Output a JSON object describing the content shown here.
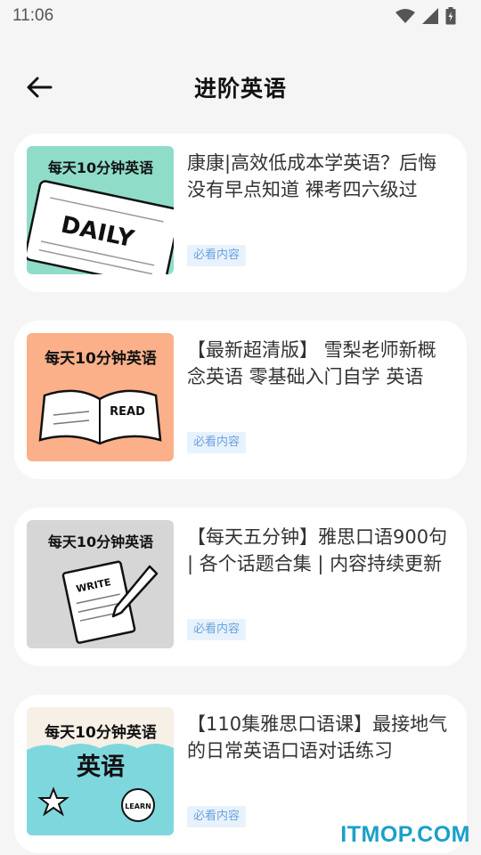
{
  "status_bar": {
    "time": "11:06",
    "icons": [
      "wifi-icon",
      "signal-icon",
      "battery-charging-icon"
    ]
  },
  "header": {
    "back_icon": "arrow-left-icon",
    "title": "进阶英语"
  },
  "courses": [
    {
      "title": "康康|高效低成本学英语？后悔没有早点知道 裸考四六级过",
      "tag": "必看内容",
      "thumb_caption": "每天10分钟英语",
      "thumb_word": "DAILY",
      "thumb_bg": "#8fdcc9"
    },
    {
      "title": "【最新超清版】 雪梨老师新概念英语  零基础入门自学 英语",
      "tag": "必看内容",
      "thumb_caption": "每天10分钟英语",
      "thumb_word": "READ",
      "thumb_bg": "#fbb08a"
    },
    {
      "title": "【每天五分钟】雅思口语900句 | 各个话题合集 | 内容持续更新",
      "tag": "必看内容",
      "thumb_caption": "每天10分钟英语",
      "thumb_word": "WRITE",
      "thumb_bg": "#d6d6d6"
    },
    {
      "title": "【110集雅思口语课】最接地气的日常英语口语对话练习",
      "tag": "必看内容",
      "thumb_caption": "每天10分钟英语",
      "thumb_big": "英语",
      "thumb_word": "LEARN",
      "thumb_bg": "#7fd7de"
    }
  ],
  "watermark": "ITMOP.COM",
  "colors": {
    "background": "#f5f5f5",
    "card": "#ffffff",
    "tag_bg": "#e8f2fc",
    "tag_text": "#6aa2df",
    "watermark": "#1aa0c8"
  }
}
